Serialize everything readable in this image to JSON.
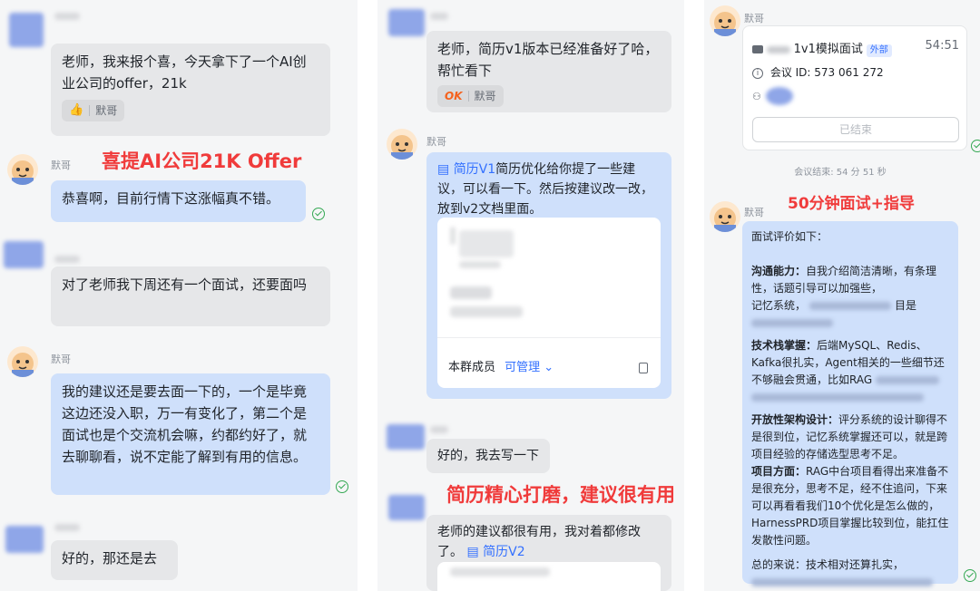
{
  "left": {
    "msg1": "老师，我来报个喜，今天拿下了一个AI创业公司的offer，21k",
    "msg1_reaction_user": "默哥",
    "caption": "喜提AI公司21K Offer",
    "sender": "默哥",
    "reply1": "恭喜啊，目前行情下这涨幅真不错。",
    "msg2": "对了老师我下周还有一个面试，还要面吗",
    "reply2": "我的建议还是要去面一下的，一个是毕竟这边还没入职，万一有变化了，第二个是面试也是个交流机会嘛，约都约好了，就去聊聊看，说不定能了解到有用的信息。",
    "msg3": "好的，那还是去"
  },
  "middle": {
    "msg1": "老师，简历v1版本已经准备好了哈，帮忙看下",
    "msg1_reaction_user": "默哥",
    "sender": "默哥",
    "reply_doc": "简历V1",
    "reply_text": "简历优化给你提了一些建议，可以看一下。然后按建议改一改，放到v2文档里面。",
    "card_members": "本群成员",
    "card_permission": "可管理",
    "msg2": "好的，我去写一下",
    "caption": "简历精心打磨，建议很有用",
    "msg3": "老师的建议都很有用，我对着都修改了。",
    "msg3_doc": "简历V2"
  },
  "right": {
    "sender": "默哥",
    "meeting_title": "1v1模拟面试",
    "meeting_tag": "外部",
    "meeting_duration": "54:51",
    "meeting_id": "会议 ID: 573 061 272",
    "meeting_ended_btn": "已结束",
    "meeting_end_note": "会议结束: 54 分 51 秒",
    "caption": "50分钟面试+指导",
    "eval_title": "面试评价如下：",
    "eval_comm_label": "沟通能力：",
    "eval_comm_text": "自我介绍简洁清晰，有条理性，话题引导可以加强些，",
    "eval_comm_text2": "记忆系统，",
    "eval_comm_text3": "目是",
    "eval_tech_label": "技术栈掌握：",
    "eval_tech_text": "后端MySQL、Redis、Kafka很扎实，Agent相关的一些细节还不够融会贯通，比如RAG",
    "eval_arch_label": "开放性架构设计：",
    "eval_arch_text": "评分系统的设计聊得不是很到位，记忆系统掌握还可以，就是跨项目经验的存储选型思考不足。",
    "eval_proj_label": "项目方面：",
    "eval_proj_text": "RAG中台项目看得出来准备不是很充分，思考不足，经不住追问，下来可以再看看我们10个优化是怎么做的，HarnessPRD项目掌握比较到位，能扛住发散性问题。",
    "eval_summary": "总的来说：技术相对还算扎实，"
  }
}
